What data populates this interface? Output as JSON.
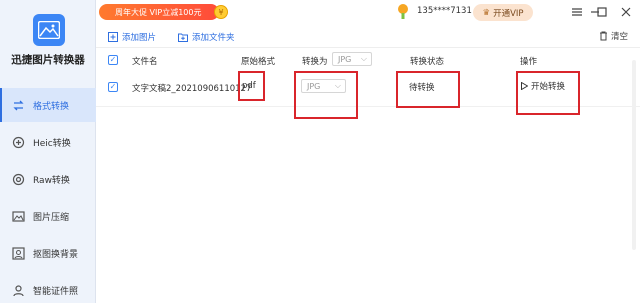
{
  "app": {
    "name": "迅捷图片转换器"
  },
  "topbar": {
    "promo_text": "周年大促 VIP立减100元",
    "user_name": "135****7131",
    "vip_label": "开通VIP",
    "window_controls": [
      "menu-icon",
      "minimize-icon",
      "maximize-icon",
      "close-icon"
    ]
  },
  "sidebar": {
    "items": [
      {
        "label": "格式转换",
        "icon": "format-convert-icon",
        "active": true
      },
      {
        "label": "Heic转换",
        "icon": "heic-icon",
        "active": false
      },
      {
        "label": "Raw转换",
        "icon": "raw-icon",
        "active": false
      },
      {
        "label": "图片压缩",
        "icon": "image-compress-icon",
        "active": false
      },
      {
        "label": "抠图换背景",
        "icon": "cutout-icon",
        "active": false
      },
      {
        "label": "智能证件照",
        "icon": "id-photo-icon",
        "active": false
      }
    ]
  },
  "toolbar": {
    "add_image": "添加图片",
    "add_folder": "添加文件夹",
    "clear": "清空"
  },
  "table": {
    "headers": {
      "filename": "文件名",
      "original_format": "原始格式",
      "convert_to": "转换为",
      "convert_to_value": "JPG",
      "status": "转换状态",
      "action": "操作"
    },
    "rows": [
      {
        "filename": "文字文稿2_20210906110127",
        "original_format": "pdf",
        "convert_to": "JPG",
        "status": "待转换",
        "action": "开始转换"
      }
    ]
  },
  "colors": {
    "accent": "#2f6fe0",
    "highlight": "#d9252b",
    "promo": "#ff5a35"
  }
}
